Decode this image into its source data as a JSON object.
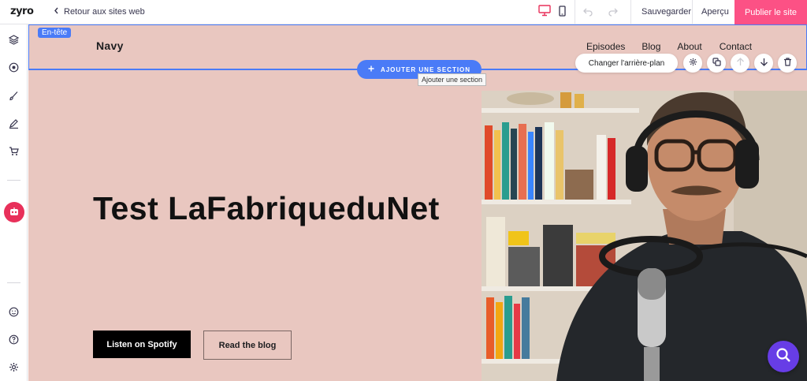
{
  "app": {
    "logo": "zyro"
  },
  "topbar": {
    "back_label": "Retour aux sites web",
    "save_label": "Sauvegarder",
    "preview_label": "Aperçu",
    "publish_label": "Publier le site",
    "publish_color": "#fc5185",
    "active_device": "desktop"
  },
  "canvas": {
    "section_badge": "En-tête",
    "brand": "Navy",
    "nav": [
      "Episodes",
      "Blog",
      "About",
      "Contact"
    ],
    "add_section_label": "AJOUTER UNE SECTION",
    "add_section_tooltip": "Ajouter une section",
    "change_bg_label": "Changer l'arrière-plan",
    "hero_title": "Test LaFabriqueduNet",
    "primary_cta": "Listen on Spotify",
    "secondary_cta": "Read the blog",
    "background_color": "#e9c7c0",
    "accent_color": "#4a7bf7"
  }
}
